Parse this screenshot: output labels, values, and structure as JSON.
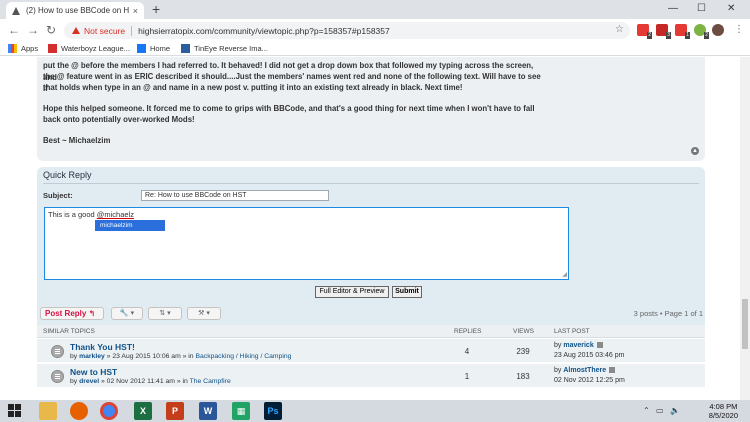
{
  "browser": {
    "tab_title": "(2) How to use BBCode on HST",
    "tab_close": "×",
    "new_tab": "+",
    "minimize": "—",
    "maximize": "☐",
    "close": "✕",
    "not_secure": "Not secure",
    "url": "highsierratopix.com/community/viewtopic.php?p=158357#p158357",
    "ext_badges": [
      "2",
      "3",
      "1",
      "2"
    ]
  },
  "bookmarks": [
    {
      "label": "Apps"
    },
    {
      "label": "Waterboyz League..."
    },
    {
      "label": "Home"
    },
    {
      "label": "TinEye Reverse Ima..."
    }
  ],
  "post": {
    "lines": [
      "put the @ before the members I had referred to. It behaved! I did not get a drop down box that followed my typing across the screen, and",
      "the @ feature went in as ERIC described it should....Just the members' names went red and none of the following text. Will have to see if",
      "that holds when type in an @ and name in a new post v. putting it into an existing text already in black. Next time!",
      "Hope this helped someone. It forced me to come to grips with BBCode, and that's a good thing for next time when I won't have to fall",
      "back onto potentially over-worked Mods!",
      "Best ~ Michaelzim"
    ]
  },
  "quick_reply": {
    "heading": "Quick Reply",
    "subject_label": "Subject:",
    "subject_value": "Re: How to use BBCode on HST",
    "message_prefix": "This is a good ",
    "message_mention": "@michaelz",
    "suggestion": "michaelzim",
    "full_editor_label": "Full Editor & Preview",
    "submit_label": "Submit"
  },
  "actions": {
    "post_reply": "Post Reply",
    "pagination": "3 posts • Page 1 of 1"
  },
  "similar_topics": {
    "headers": {
      "topics": "Similar Topics",
      "replies": "Replies",
      "views": "Views",
      "last_post": "Last Post"
    },
    "rows": [
      {
        "title": "Thank You HST!",
        "by": "by",
        "author": "markley",
        "date": "» 23 Aug 2015 10:06 am » in",
        "forum": "Backpacking / Hiking / Camping",
        "replies": "4",
        "views": "239",
        "last_by": "by",
        "last_author": "maverick",
        "last_date": "23 Aug 2015 03:46 pm"
      },
      {
        "title": "New to HST",
        "by": "by",
        "author": "drevel",
        "date": "» 02 Nov 2012 11:41 am » in",
        "forum": "The Campfire",
        "replies": "1",
        "views": "183",
        "last_by": "by",
        "last_author": "AlmostThere",
        "last_date": "02 Nov 2012 12:25 pm"
      }
    ]
  },
  "taskbar": {
    "time": "4:08 PM",
    "date": "8/5/2020"
  }
}
